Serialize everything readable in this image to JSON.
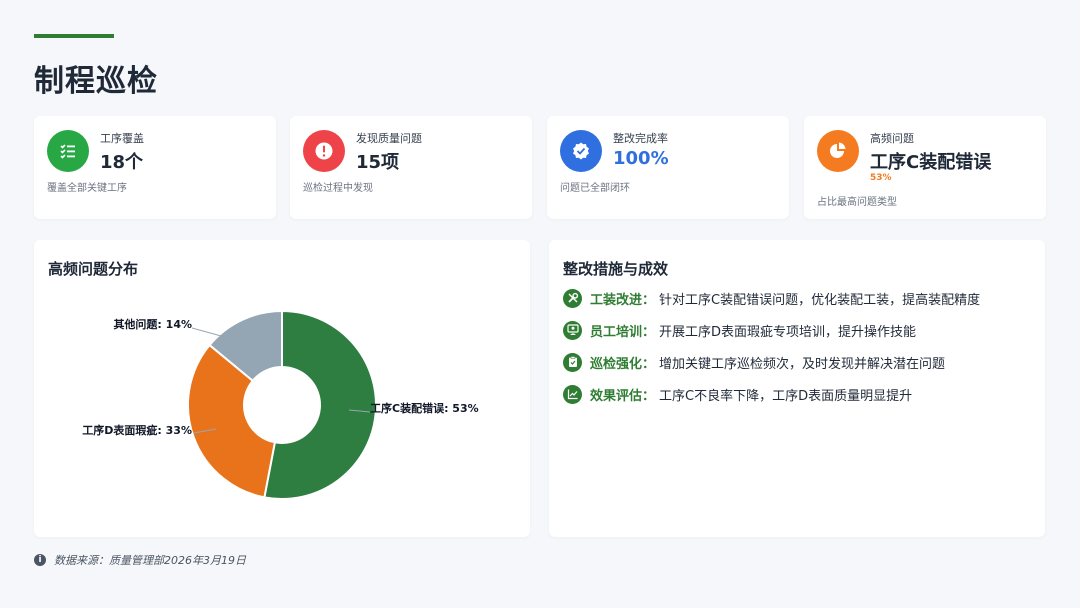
{
  "page": {
    "title": "制程巡检"
  },
  "kpis": [
    {
      "icon": "checklist-icon",
      "color": "#28a745",
      "label": "工序覆盖",
      "value": "18个",
      "desc": "覆盖全部关键工序"
    },
    {
      "icon": "exclamation-icon",
      "color": "#ee4449",
      "label": "发现质量问题",
      "value": "15项",
      "desc": "巡检过程中发现"
    },
    {
      "icon": "check-badge-icon",
      "color": "#2f6fe0",
      "label": "整改完成率",
      "value": "100%",
      "value_color": "#2f6fe0",
      "desc": "问题已全部闭环"
    },
    {
      "icon": "pie-chart-icon",
      "color": "#f47b20",
      "label": "高频问题",
      "value": "工序C装配错误",
      "sub": "53%",
      "desc": "占比最高问题类型"
    }
  ],
  "chart_panel": {
    "title": "高频问题分布"
  },
  "chart_data": {
    "type": "pie",
    "donut": true,
    "title": "",
    "slices": [
      {
        "label": "工序C装配错误",
        "value": 53,
        "color": "#2e7d41",
        "text": "工序C装配错误: 53%"
      },
      {
        "label": "工序D表面瑕疵",
        "value": 33,
        "color": "#e8731a",
        "text": "工序D表面瑕疵: 33%"
      },
      {
        "label": "其他问题",
        "value": 14,
        "color": "#94a6b4",
        "text": "其他问题: 14%"
      }
    ]
  },
  "measures_panel": {
    "title": "整改措施与成效",
    "items": [
      {
        "icon": "wrench-icon",
        "key": "工装改进",
        "sep": "：",
        "text": "针对工序C装配错误问题，优化装配工装，提高装配精度"
      },
      {
        "icon": "trainer-icon",
        "key": "员工培训",
        "sep": "：",
        "text": "开展工序D表面瑕疵专项培训，提升操作技能"
      },
      {
        "icon": "clipboard-icon",
        "key": "巡检强化",
        "sep": "：",
        "text": "增加关键工序巡检频次，及时发现并解决潜在问题"
      },
      {
        "icon": "trend-chart-icon",
        "key": "效果评估",
        "sep": "：",
        "text": "工序C不良率下降，工序D表面质量明显提升"
      }
    ]
  },
  "footer": {
    "icon_glyph": "i",
    "text": "数据来源：质量管理部2026年3月19日"
  }
}
